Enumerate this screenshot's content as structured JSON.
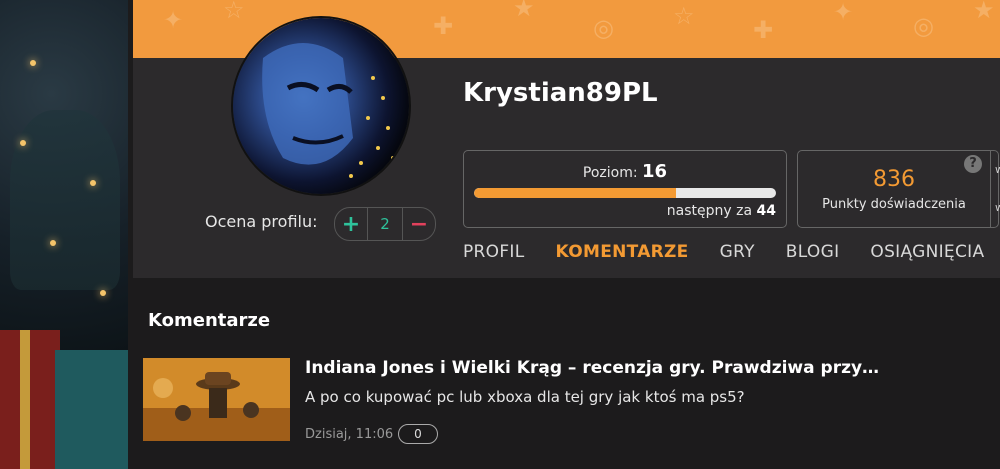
{
  "profile": {
    "username": "Krystian89PL",
    "rating_label": "Ocena profilu:",
    "rating_value": "2",
    "rating_plus": "+",
    "rating_minus": "−"
  },
  "level": {
    "label": "Poziom:",
    "value": "16",
    "progress_fraction": 0.67,
    "next_label": "następny za",
    "next_value": "44"
  },
  "experience": {
    "value": "836",
    "label": "Punkty doświadczenia",
    "help": "?",
    "side_1": "w",
    "side_2": "w"
  },
  "tabs": [
    {
      "label": "PROFIL",
      "active": false
    },
    {
      "label": "KOMENTARZE",
      "active": true
    },
    {
      "label": "GRY",
      "active": false
    },
    {
      "label": "BLOGI",
      "active": false
    },
    {
      "label": "OSIĄGNIĘCIA",
      "active": false
    }
  ],
  "comments_section": {
    "title": "Komentarze",
    "items": [
      {
        "title": "Indiana Jones i Wielki Krąg – recenzja gry. Prawdziwa przy…",
        "text": "A po co kupować pc lub xboxa dla tej gry jak ktoś ma ps5?",
        "time": "Dzisiaj, 11:06",
        "count": "0"
      }
    ]
  },
  "colors": {
    "accent": "#f39a33",
    "banner": "#f29a3e",
    "panel": "#2c2a2c",
    "background": "#1c1b1c",
    "positive": "#2ec29b",
    "negative": "#e2415c"
  }
}
